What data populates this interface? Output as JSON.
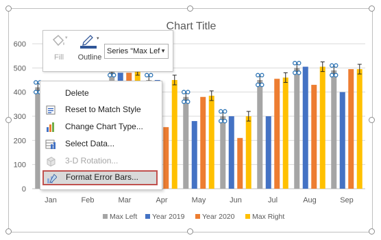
{
  "chart_data": {
    "type": "bar",
    "title": "Chart Title",
    "categories": [
      "Jan",
      "Feb",
      "Mar",
      "Apr",
      "May",
      "Jun",
      "Jul",
      "Aug",
      "Sep"
    ],
    "ylim": [
      0,
      600
    ],
    "yticks": [
      0,
      100,
      200,
      300,
      400,
      500,
      600
    ],
    "grid": true,
    "legend_position": "bottom",
    "series": [
      {
        "name": "Max Left",
        "color": "#a5a5a5",
        "values": [
          420,
          400,
          490,
          450,
          380,
          300,
          450,
          500,
          490
        ],
        "error_bars": true,
        "selected": true
      },
      {
        "name": "Year 2019",
        "color": "#4472c4",
        "values": [
          400,
          390,
          480,
          450,
          280,
          300,
          300,
          505,
          400
        ],
        "error_bars": false
      },
      {
        "name": "Year 2020",
        "color": "#ed7d31",
        "values": [
          380,
          370,
          480,
          255,
          380,
          210,
          455,
          430,
          495
        ],
        "error_bars": false
      },
      {
        "name": "Max Right",
        "color": "#ffc000",
        "values": [
          420,
          400,
          490,
          450,
          385,
          300,
          460,
          505,
          495
        ],
        "error_bars": true,
        "selected": false
      }
    ]
  },
  "toolbar": {
    "fill_label": "Fill",
    "outline_label": "Outline",
    "series_select_value": "Series \"Max Lef"
  },
  "menu": {
    "items": [
      {
        "label": "Delete",
        "icon": "delete-icon",
        "disabled": false,
        "selected": false
      },
      {
        "label": "Reset to Match Style",
        "icon": "reset-style-icon",
        "disabled": false,
        "selected": false
      },
      {
        "label": "Change Chart Type...",
        "icon": "chart-type-icon",
        "disabled": false,
        "selected": false
      },
      {
        "label": "Select Data...",
        "icon": "select-data-icon",
        "disabled": false,
        "selected": false
      },
      {
        "label": "3-D Rotation...",
        "icon": "rotation-3d-icon",
        "disabled": true,
        "selected": false
      },
      {
        "label": "Format Error Bars...",
        "icon": "format-error-bars-icon",
        "disabled": false,
        "selected": true
      }
    ]
  }
}
